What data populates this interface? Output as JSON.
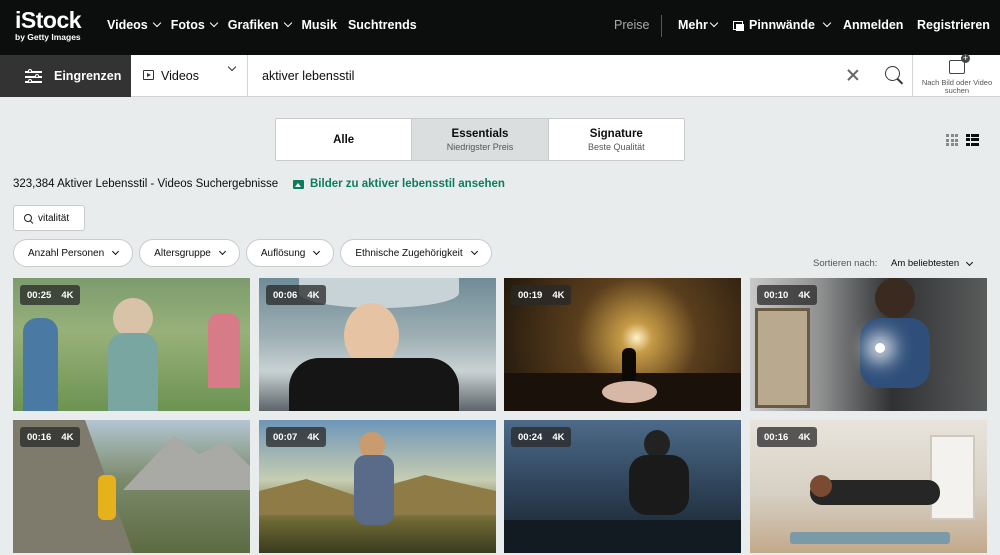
{
  "brand": {
    "logo": "iStock",
    "sub": "by Getty Images"
  },
  "nav": {
    "items": [
      {
        "label": "Videos"
      },
      {
        "label": "Fotos"
      },
      {
        "label": "Grafiken"
      },
      {
        "label": "Musik"
      },
      {
        "label": "Suchtrends"
      }
    ],
    "preise": "Preise",
    "mehr": "Mehr",
    "pinnwaende": "Pinnwände",
    "anmelden": "Anmelden",
    "registrieren": "Registrieren"
  },
  "search": {
    "filter_button": "Eingrenzen",
    "media_type": "Videos",
    "query": "aktiver lebensstil",
    "image_search_label": "Nach Bild oder Video suchen"
  },
  "collections": [
    {
      "title": "Alle",
      "subtitle": "",
      "active": false
    },
    {
      "title": "Essentials",
      "subtitle": "Niedrigster Preis",
      "active": true
    },
    {
      "title": "Signature",
      "subtitle": "Beste Qualität",
      "active": false
    }
  ],
  "results": {
    "count_text": "323,384 Aktiver Lebensstil - Videos Suchergebnisse",
    "images_link": "Bilder zu aktiver lebensstil ansehen"
  },
  "related_tag": "vitalität",
  "filters": [
    "Anzahl Personen",
    "Altersgruppe",
    "Auflösung",
    "Ethnische Zugehörigkeit"
  ],
  "sort": {
    "label": "Sortieren nach:",
    "value": "Am beliebtesten"
  },
  "thumbnails": [
    {
      "duration": "00:25",
      "quality": "4K"
    },
    {
      "duration": "00:06",
      "quality": "4K"
    },
    {
      "duration": "00:19",
      "quality": "4K"
    },
    {
      "duration": "00:10",
      "quality": "4K"
    },
    {
      "duration": "00:16",
      "quality": "4K"
    },
    {
      "duration": "00:07",
      "quality": "4K"
    },
    {
      "duration": "00:24",
      "quality": "4K"
    },
    {
      "duration": "00:16",
      "quality": "4K"
    }
  ],
  "colors": {
    "accent": "#0a7d5f",
    "nav_bg": "#0c0d0d",
    "page_bg": "#e9ecec"
  }
}
